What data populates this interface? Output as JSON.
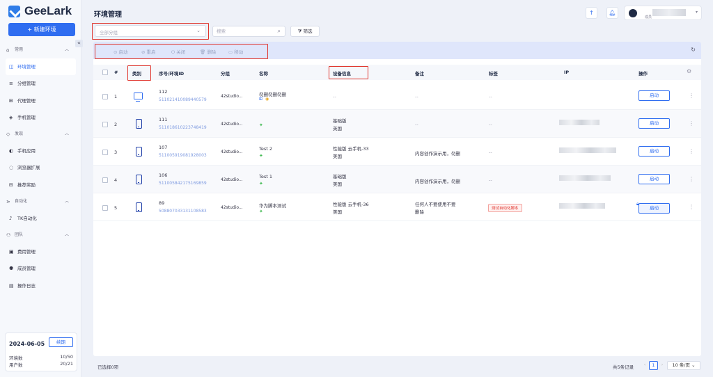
{
  "brand": {
    "name": "GeeLark"
  },
  "sidebar": {
    "new_env_label": "+ 新建环境",
    "collapse_icon": "«",
    "groups": [
      {
        "label": "常用",
        "items": [
          "环境管理",
          "分组管理",
          "代理管理",
          "手机管理"
        ]
      },
      {
        "label": "发现",
        "items": [
          "手机应用",
          "浏览器扩展",
          "推荐奖励"
        ]
      },
      {
        "label": "自动化",
        "items": [
          "TK自动化"
        ]
      },
      {
        "label": "团队",
        "items": [
          "费用管理",
          "成员管理",
          "操作日志"
        ]
      }
    ],
    "subscription": {
      "date": "2024-06-05",
      "renew_label": "续期",
      "env_label": "环境数",
      "env_value": "10/50",
      "user_label": "用户数",
      "user_value": "20/21"
    }
  },
  "header": {
    "title": "环境管理",
    "user_role": "成员"
  },
  "filters": {
    "group_placeholder": "全部分组",
    "search_placeholder": "搜索",
    "filter_label": "筛选"
  },
  "toolbar": {
    "start": "启动",
    "restart": "重启",
    "close": "关闭",
    "delete": "删除",
    "move": "移动"
  },
  "table": {
    "headers": {
      "index": "#",
      "category": "类别",
      "serial": "序号/环境ID",
      "group": "分组",
      "name": "名称",
      "device": "设备信息",
      "remark": "备注",
      "tags": "标签",
      "ip": "IP",
      "actions": "操作"
    },
    "rows": [
      {
        "index": "1",
        "type": "desktop",
        "serial": "112",
        "env_id": "511021410089440579",
        "group": "42studio...",
        "name": "勿删勿删勿删",
        "device_line1": "--",
        "device_line2": "",
        "remark": "--",
        "tag": "--",
        "action": "启动",
        "locked": false,
        "ip_visible": false
      },
      {
        "index": "2",
        "type": "phone",
        "serial": "111",
        "env_id": "511018610223748419",
        "group": "42studio...",
        "name": "",
        "device_line1": "基础版",
        "device_line2": "英国",
        "remark": "--",
        "tag": "--",
        "action": "启动",
        "locked": false,
        "ip_visible": true
      },
      {
        "index": "3",
        "type": "phone",
        "serial": "107",
        "env_id": "511005919081928003",
        "group": "42studio...",
        "name": "Test 2",
        "device_line1": "性能版 云手机-33",
        "device_line2": "美国",
        "remark": "内容创作演示用，勿删",
        "tag": "--",
        "action": "启动",
        "locked": false,
        "ip_visible": true
      },
      {
        "index": "4",
        "type": "phone",
        "serial": "106",
        "env_id": "511005842175169859",
        "group": "42studio...",
        "name": "Test 1",
        "device_line1": "基础版",
        "device_line2": "美国",
        "remark": "内容创作演示用，勿删",
        "tag": "--",
        "action": "启动",
        "locked": false,
        "ip_visible": true
      },
      {
        "index": "5",
        "type": "phone",
        "serial": "89",
        "env_id": "508807033131108583",
        "group": "42studio...",
        "name": "华为脚本测试",
        "device_line1": "性能版 云手机-36",
        "device_line2": "美国",
        "remark": "任何人不要使用不要删除",
        "tag": "测试自动化脚本",
        "action": "启动",
        "locked": true,
        "ip_visible": true
      }
    ]
  },
  "footer": {
    "selected": "已选择0项",
    "total": "共5条记录",
    "page": "1",
    "page_size": "10 条/页"
  },
  "colors": {
    "accent": "#2f6df0",
    "highlight": "#e0342c"
  }
}
